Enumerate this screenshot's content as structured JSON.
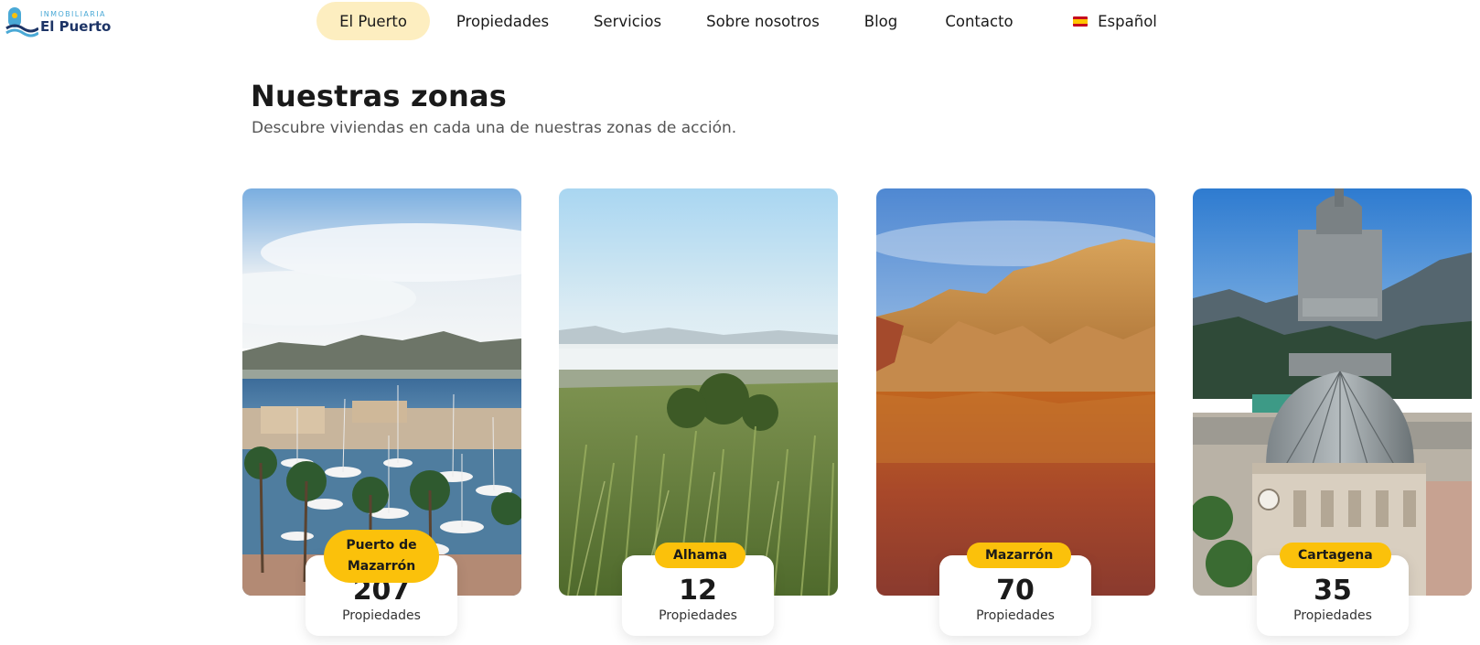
{
  "brand": {
    "tagline": "INMOBILIARIA",
    "name": "El Puerto"
  },
  "nav": {
    "items": [
      "El Puerto",
      "Propiedades",
      "Servicios",
      "Sobre nosotros",
      "Blog",
      "Contacto"
    ],
    "active_index": 0,
    "language": "Español",
    "language_icon": "spain-flag-icon"
  },
  "section": {
    "title": "Nuestras zonas",
    "subtitle": "Descubre viviendas en cada una de nuestras zonas de acción."
  },
  "zones": [
    {
      "name": "Puerto de Mazarrón",
      "count": "207",
      "count_label": "Propiedades",
      "image": "marina-harbor-photo"
    },
    {
      "name": "Alhama",
      "count": "12",
      "count_label": "Propiedades",
      "image": "misty-valley-vegetation-photo"
    },
    {
      "name": "Mazarrón",
      "count": "70",
      "count_label": "Propiedades",
      "image": "red-lake-rock-formations-photo"
    },
    {
      "name": "Cartagena",
      "count": "35",
      "count_label": "Propiedades",
      "image": "city-dome-tower-photo"
    }
  ],
  "colors": {
    "accent": "#fbc10b",
    "nav_active_bg": "#fdeec0",
    "brand_navy": "#1d3466",
    "brand_sky": "#4aa9d6"
  }
}
